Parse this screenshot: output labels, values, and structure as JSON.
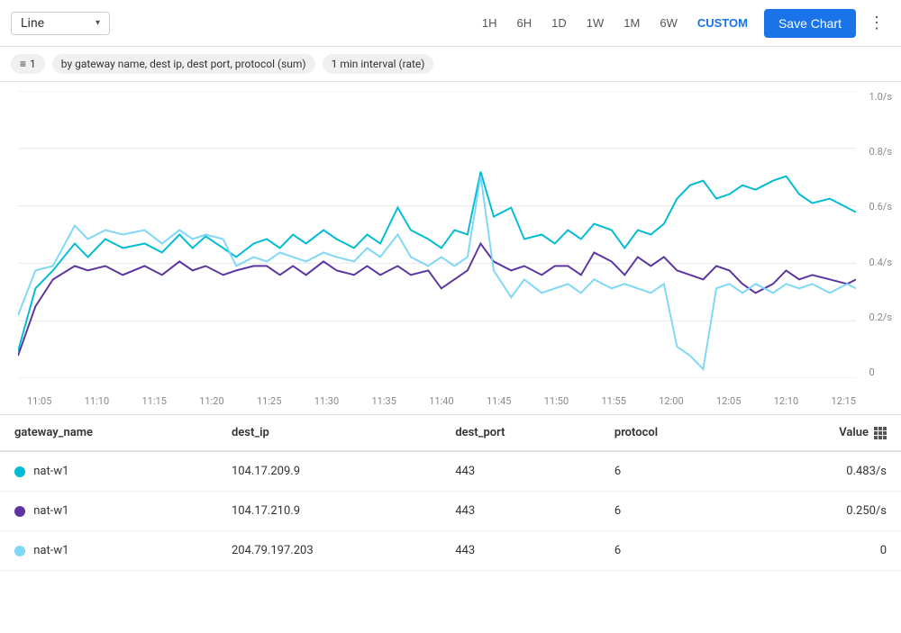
{
  "toolbar": {
    "chart_type": "Line",
    "dropdown_arrow": "▾",
    "time_buttons": [
      {
        "label": "1H",
        "active": false
      },
      {
        "label": "6H",
        "active": false
      },
      {
        "label": "1D",
        "active": false
      },
      {
        "label": "1W",
        "active": false
      },
      {
        "label": "1M",
        "active": false
      },
      {
        "label": "6W",
        "active": false
      },
      {
        "label": "CUSTOM",
        "active": true
      }
    ],
    "save_label": "Save Chart",
    "more_icon": "⋮"
  },
  "filter_bar": {
    "filter_count": "≡ 1",
    "group_by_label": "by gateway name, dest ip, dest port, protocol (sum)",
    "interval_label": "1 min interval (rate)"
  },
  "chart": {
    "y_labels": [
      "1.0/s",
      "0.8/s",
      "0.6/s",
      "0.4/s",
      "0.2/s",
      "0"
    ],
    "x_labels": [
      "11:05",
      "11:10",
      "11:15",
      "11:20",
      "11:25",
      "11:30",
      "11:35",
      "11:40",
      "11:45",
      "11:50",
      "11:55",
      "12:00",
      "12:05",
      "12:10",
      "12:15"
    ],
    "colors": {
      "teal": "#00bcd4",
      "purple": "#5c35a0",
      "light_blue": "#7fd7f7"
    }
  },
  "table": {
    "columns": [
      "gateway_name",
      "dest_ip",
      "dest_port",
      "protocol",
      "Value"
    ],
    "rows": [
      {
        "dot_color": "#00bcd4",
        "gateway_name": "nat-w1",
        "dest_ip": "104.17.209.9",
        "dest_port": "443",
        "protocol": "6",
        "value": "0.483/s"
      },
      {
        "dot_color": "#5c35a0",
        "gateway_name": "nat-w1",
        "dest_ip": "104.17.210.9",
        "dest_port": "443",
        "protocol": "6",
        "value": "0.250/s"
      },
      {
        "dot_color": "#7fd7f7",
        "gateway_name": "nat-w1",
        "dest_ip": "204.79.197.203",
        "dest_port": "443",
        "protocol": "6",
        "value": "0"
      }
    ]
  }
}
